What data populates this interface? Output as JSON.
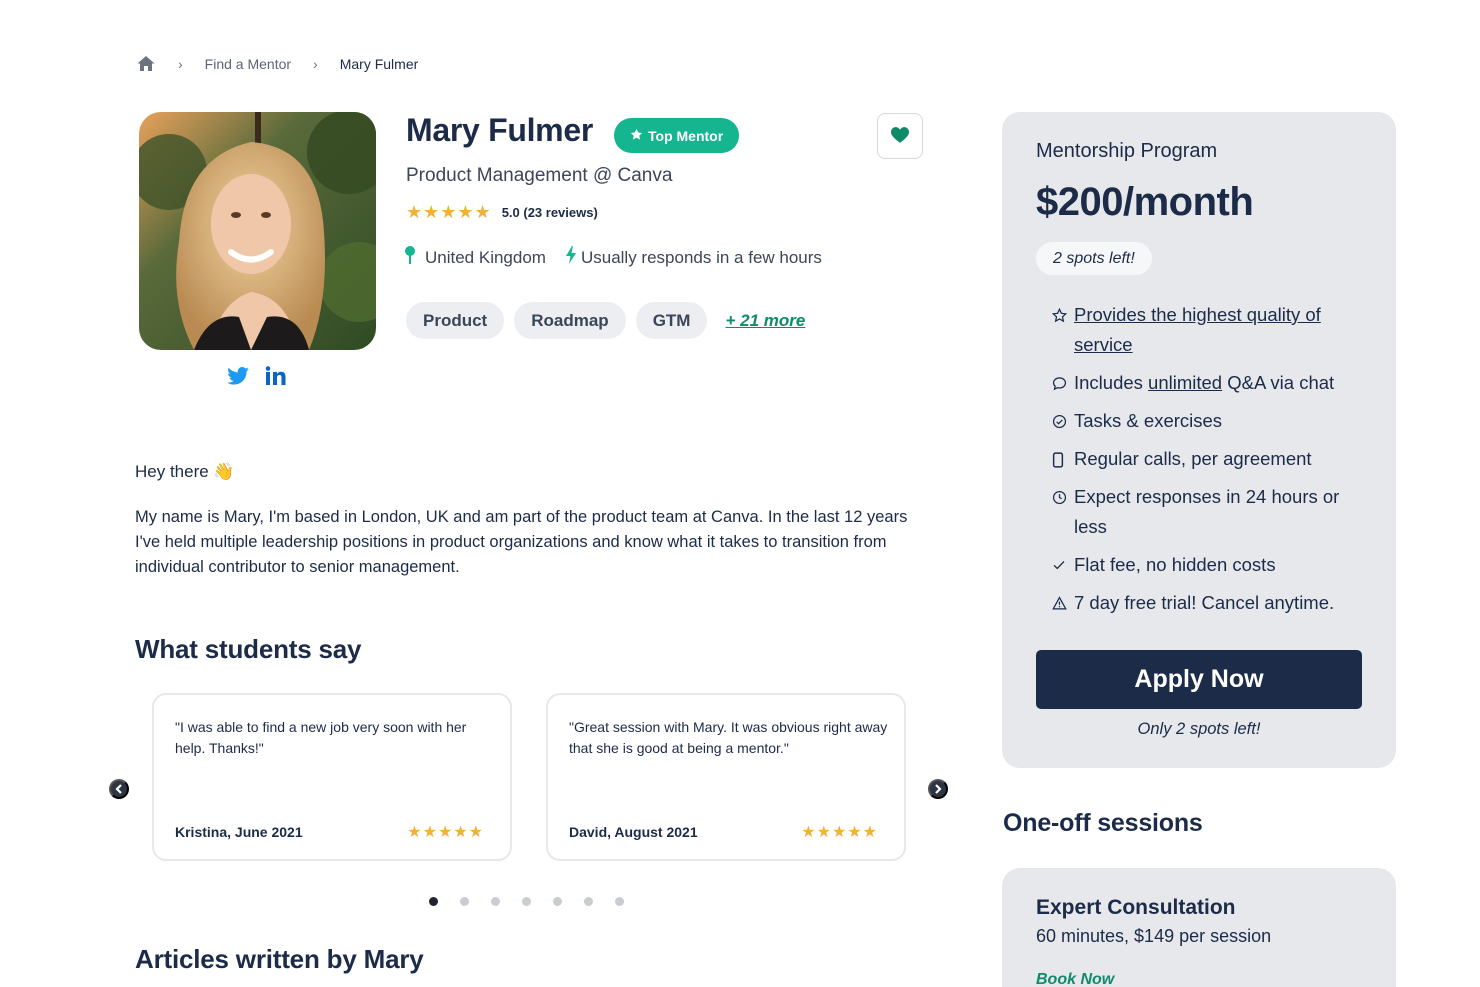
{
  "breadcrumb": {
    "items": [
      "Find a Mentor",
      "Mary Fulmer"
    ]
  },
  "profile": {
    "name": "Mary Fulmer",
    "badge": "Top Mentor",
    "title": "Product Management @ Canva",
    "rating_stars": "★★★★★",
    "rating_text": "5.0 (23 reviews)",
    "location": "United Kingdom",
    "response": "Usually responds in a few hours",
    "tags": [
      "Product",
      "Roadmap",
      "GTM"
    ],
    "more_tags": "+ 21 more"
  },
  "about": {
    "greeting": "Hey there 👋",
    "bio": "My name is Mary, I'm based in London, UK and am part of the product team at Canva. In the last 12 years I've held multiple leadership positions in product organizations and know what it takes to transition from individual contributor to senior management."
  },
  "reviews": {
    "heading": "What students say",
    "items": [
      {
        "text": "\"I was able to find a new job very soon with her help. Thanks!\"",
        "author": "Kristina, June 2021",
        "stars": "★★★★★"
      },
      {
        "text": "\"Great session with Mary. It was obvious right away that she is good at being a mentor.\"",
        "author": "David, August 2021",
        "stars": "★★★★★"
      }
    ],
    "page_count": 7,
    "active_page": 1
  },
  "articles": {
    "heading": "Articles written by Mary"
  },
  "program": {
    "label": "Mentorship Program",
    "price": "$200/month",
    "spots_pill": "2 spots left!",
    "features": {
      "f1": "Provides the highest quality of service",
      "f2a": "Includes ",
      "f2b": "unlimited",
      "f2c": " Q&A via chat",
      "f3": "Tasks & exercises",
      "f4": "Regular calls, per agreement",
      "f5": "Expect responses in 24 hours or less",
      "f6": "Flat fee, no hidden costs",
      "f7": "7 day free trial! Cancel anytime."
    },
    "apply_label": "Apply Now",
    "only_spots": "Only 2 spots left!"
  },
  "sessions": {
    "heading": "One-off sessions",
    "items": [
      {
        "title": "Expert Consultation",
        "desc": "60 minutes, $149 per session",
        "book": "Book Now"
      }
    ]
  },
  "colors": {
    "navy": "#1c2b48",
    "accent_green": "#15b58f",
    "link_green": "#0f8b6a",
    "star": "#f3b13a",
    "card_bg": "#e6e8ec"
  }
}
